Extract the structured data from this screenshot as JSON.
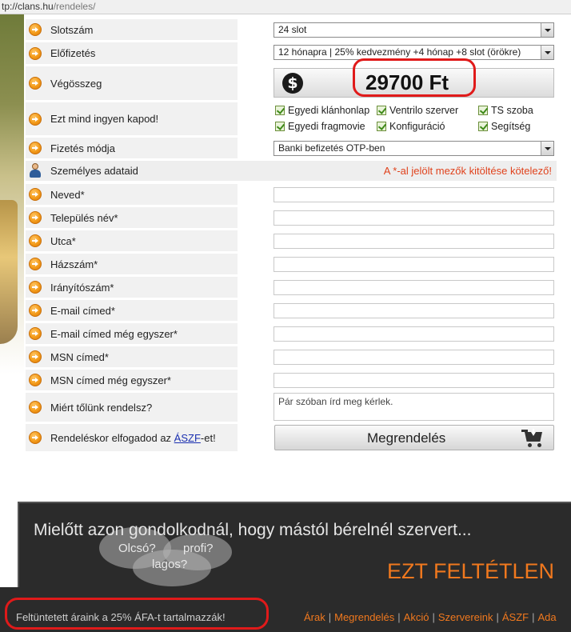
{
  "browser": {
    "url_prefix": "tp://clans.hu",
    "url_path": "/rendeles/"
  },
  "form": {
    "slot_label": "Slotszám",
    "slot_value": "24 slot",
    "subscription_label": "Előfizetés",
    "subscription_value": "12 hónapra | 25% kedvezmény +4 hónap +8 slot (örökre)",
    "total_label": "Végösszeg",
    "currency_symbol": "$",
    "total_value": "29700 Ft",
    "free_label": "Ezt mind ingyen kapod!",
    "free_items": [
      "Egyedi klánhonlap",
      "Ventrilo szerver",
      "TS szoba",
      "Egyedi fragmovie",
      "Konfiguráció",
      "Segítség"
    ],
    "payment_label": "Fizetés módja",
    "payment_value": "Banki befizetés OTP-ben"
  },
  "personal": {
    "title": "Személyes adataid",
    "required_note": "A *-al jelölt mezők kitöltése kötelező!",
    "fields": [
      "Neved*",
      "Település név*",
      "Utca*",
      "Házszám*",
      "Irányítószám*",
      "E-mail címed*",
      "E-mail címed még egyszer*",
      "MSN címed*",
      "MSN címed még egyszer*"
    ],
    "why_label": "Miért tőlünk rendelsz?",
    "why_placeholder": "Pár szóban írd meg kérlek.",
    "terms_prefix": "Rendeléskor elfogadod az ",
    "terms_link": "ÁSZF",
    "terms_suffix": "-et!",
    "order_button": "Megrendelés"
  },
  "banner": {
    "headline": "Mielőtt azon gondolkodnál, hogy mástól bérelnél szervert...",
    "bubble_1": "Olcsó?",
    "bubble_2": "profi?",
    "bubble_3": "lagos?",
    "cta": "EZT FELTÉTLEN"
  },
  "footer": {
    "vat_note": "Feltüntetett áraink a 25% ÁFA-t tartalmazzák!",
    "nav": [
      "Árak",
      "Megrendelés",
      "Akció",
      "Szervereink",
      "ÁSZF",
      "Ada"
    ]
  },
  "colors": {
    "accent_orange": "#f0781e",
    "highlight_red": "#e01a1a",
    "note_red": "#e0421c"
  }
}
